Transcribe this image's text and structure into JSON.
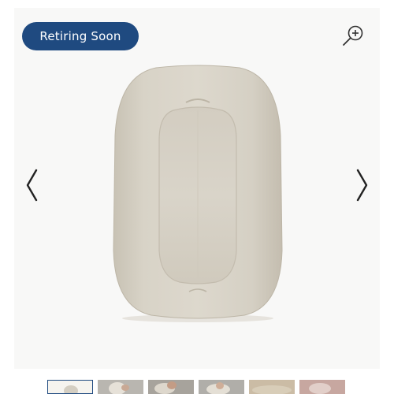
{
  "badge": {
    "label": "Retiring Soon"
  },
  "icons": {
    "zoom": "zoom-in-icon",
    "prev": "chevron-left-icon",
    "next": "chevron-right-icon"
  },
  "colors": {
    "badge_bg": "#1f4a80",
    "badge_text": "#ffffff",
    "product_fabric": "#d4cfc3",
    "active_thumb_border": "#1f4a80"
  },
  "thumbnails": {
    "count": 6,
    "active_index": 0
  }
}
